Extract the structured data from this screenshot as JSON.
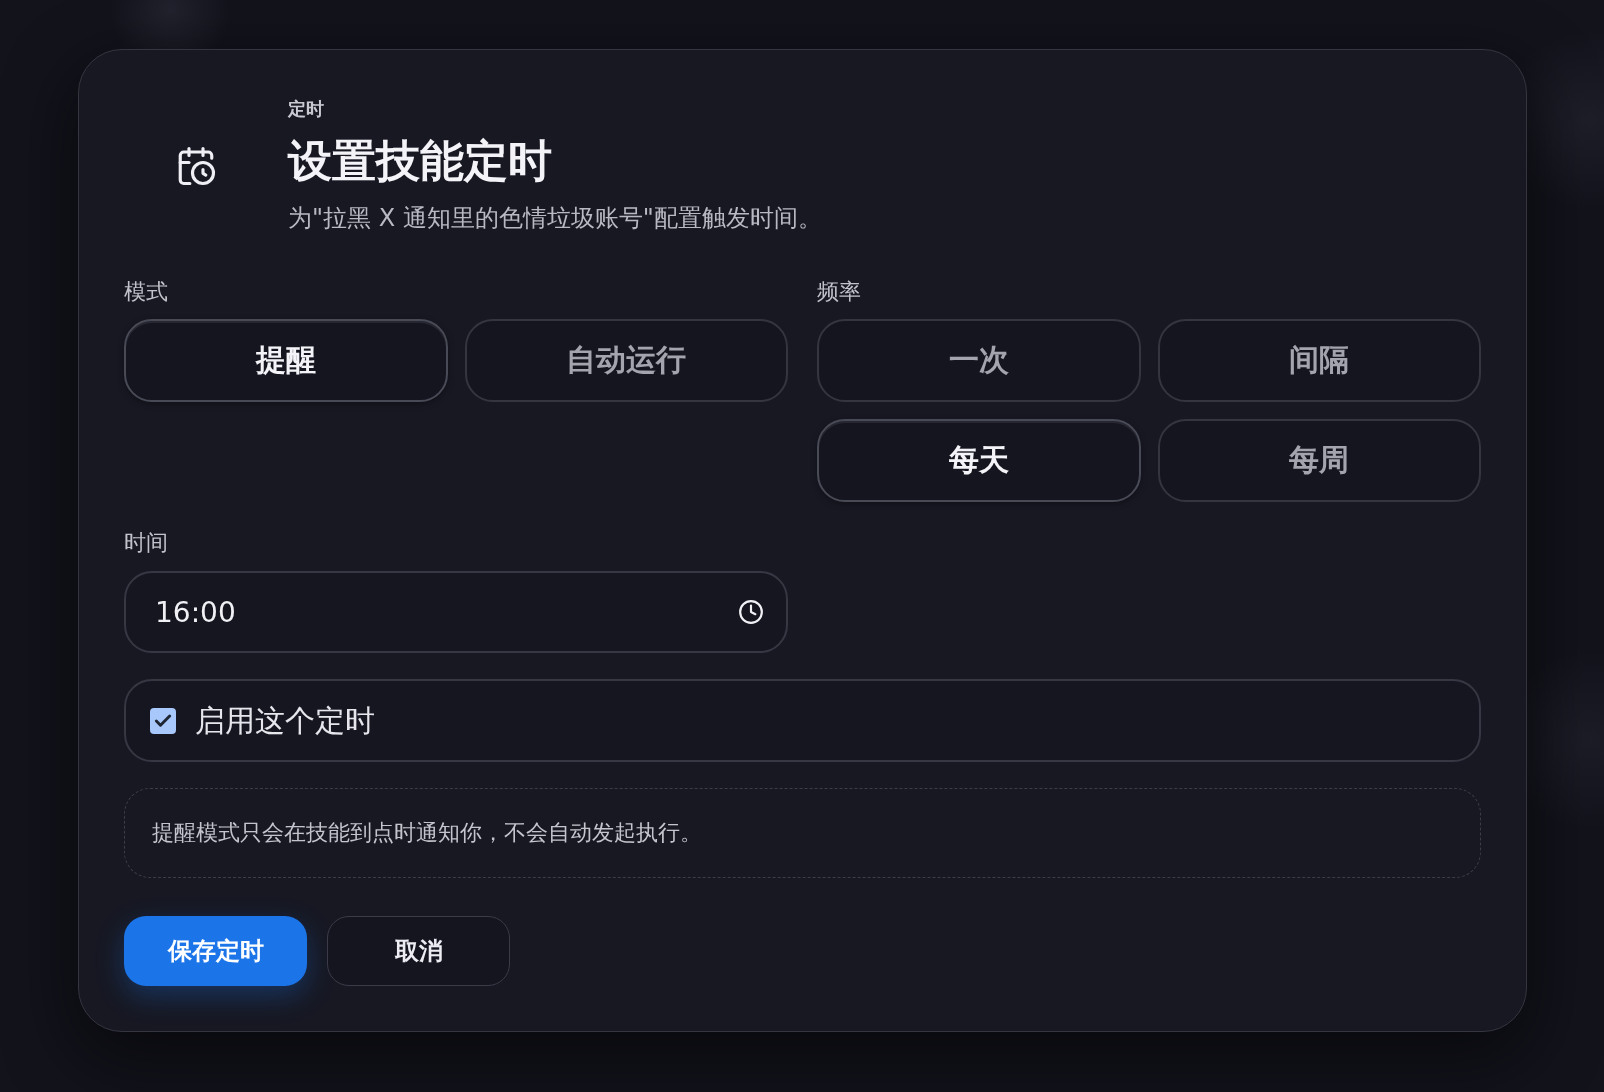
{
  "dialog": {
    "eyebrow": "定时",
    "title": "设置技能定时",
    "description": "为\"拉黑 X 通知里的色情垃圾账号\"配置触发时间。"
  },
  "mode": {
    "label": "模式",
    "options": [
      {
        "label": "提醒",
        "selected": true
      },
      {
        "label": "自动运行",
        "selected": false
      }
    ]
  },
  "frequency": {
    "label": "频率",
    "options": [
      {
        "label": "一次",
        "selected": false
      },
      {
        "label": "间隔",
        "selected": false
      },
      {
        "label": "每天",
        "selected": true
      },
      {
        "label": "每周",
        "selected": false
      }
    ]
  },
  "time": {
    "label": "时间",
    "value": "16:00"
  },
  "enabled": {
    "label": "启用这个定时",
    "checked": true
  },
  "hint": "提醒模式只会在技能到点时通知你，不会自动发起执行。",
  "actions": [
    {
      "label": "保存定时",
      "kind": "primary"
    },
    {
      "label": "取消",
      "kind": "secondary"
    }
  ]
}
